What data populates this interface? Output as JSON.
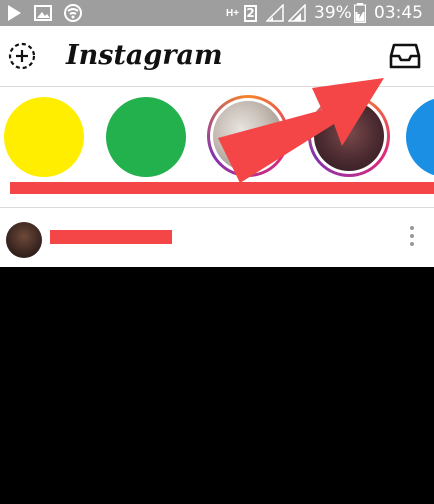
{
  "status_bar": {
    "battery_percent": "39%",
    "time": "03:45",
    "network_type": "H+",
    "sim_slot": "2",
    "icons": [
      "play-icon",
      "image-icon",
      "wifi-icon",
      "hplus-icon",
      "sim2-icon",
      "signal-weak-icon",
      "signal-icon",
      "battery-charging-icon"
    ]
  },
  "header": {
    "logo_text": "Instagram",
    "left_icon": "new-post-icon",
    "right_icon": "inbox-icon"
  },
  "stories": [
    {
      "type": "solid",
      "color": "#ffee00"
    },
    {
      "type": "solid",
      "color": "#22b14c"
    },
    {
      "type": "photo",
      "ring": true
    },
    {
      "type": "photo",
      "ring": true
    },
    {
      "type": "solid",
      "color": "#1a8fe3"
    }
  ],
  "annotations": {
    "redaction_color": "#f44646",
    "arrow_color": "#f44646"
  },
  "post": {
    "menu_icon": "more-vertical-icon"
  },
  "colors": {
    "status_bar": "#9e9e9e",
    "background": "#000000",
    "surface": "#ffffff",
    "ring_orange": "#f58529",
    "ring_purple": "#c13584"
  }
}
